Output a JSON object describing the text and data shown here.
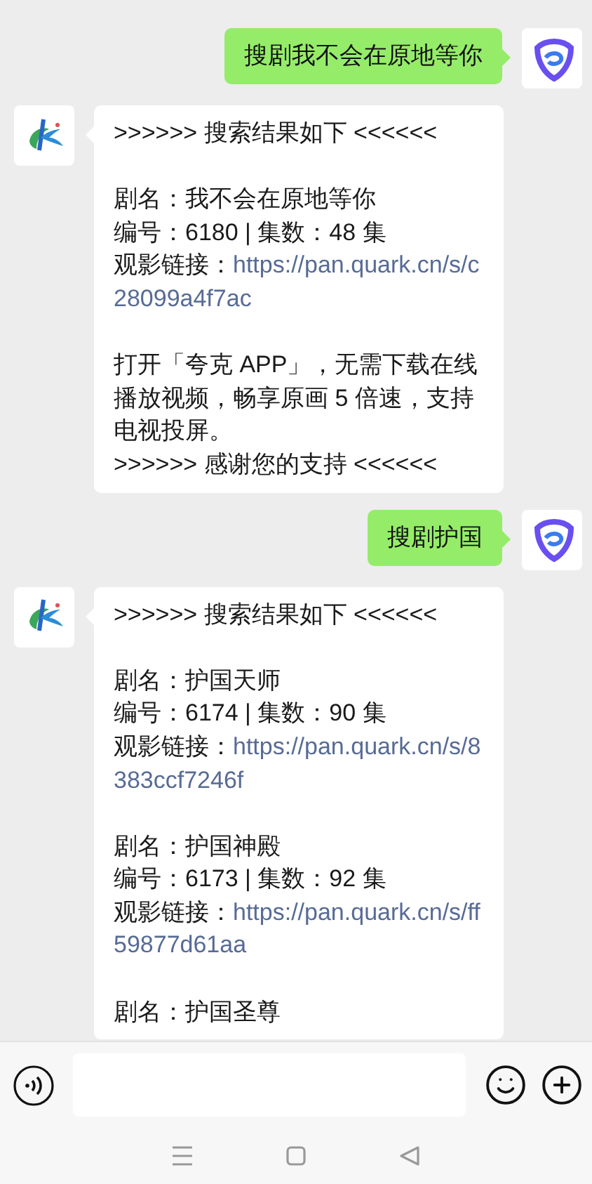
{
  "messages": [
    {
      "kind": "sent",
      "text": "搜剧我不会在原地等你"
    },
    {
      "kind": "received",
      "header": ">>>>>> 搜索结果如下 <<<<<<",
      "entries": [
        {
          "title": "剧名：我不会在原地等你",
          "meta": "编号：6180 | 集数：48 集",
          "link_label": "观影链接：",
          "link": "https://pan.quark.cn/s/c28099a4f7ac"
        }
      ],
      "note": "打开「夸克 APP」，无需下载在线播放视频，畅享原画 5 倍速，支持电视投屏。",
      "footer": ">>>>>> 感谢您的支持 <<<<<<"
    },
    {
      "kind": "sent",
      "text": "搜剧护国"
    },
    {
      "kind": "received",
      "header": ">>>>>> 搜索结果如下 <<<<<<",
      "entries": [
        {
          "title": "剧名：护国天师",
          "meta": "编号：6174 | 集数：90 集",
          "link_label": "观影链接：",
          "link": "https://pan.quark.cn/s/8383ccf7246f"
        },
        {
          "title": "剧名：护国神殿",
          "meta": "编号：6173 | 集数：92 集",
          "link_label": "观影链接：",
          "link": "https://pan.quark.cn/s/ff59877d61aa"
        },
        {
          "title": "剧名：护国圣尊"
        }
      ]
    }
  ]
}
